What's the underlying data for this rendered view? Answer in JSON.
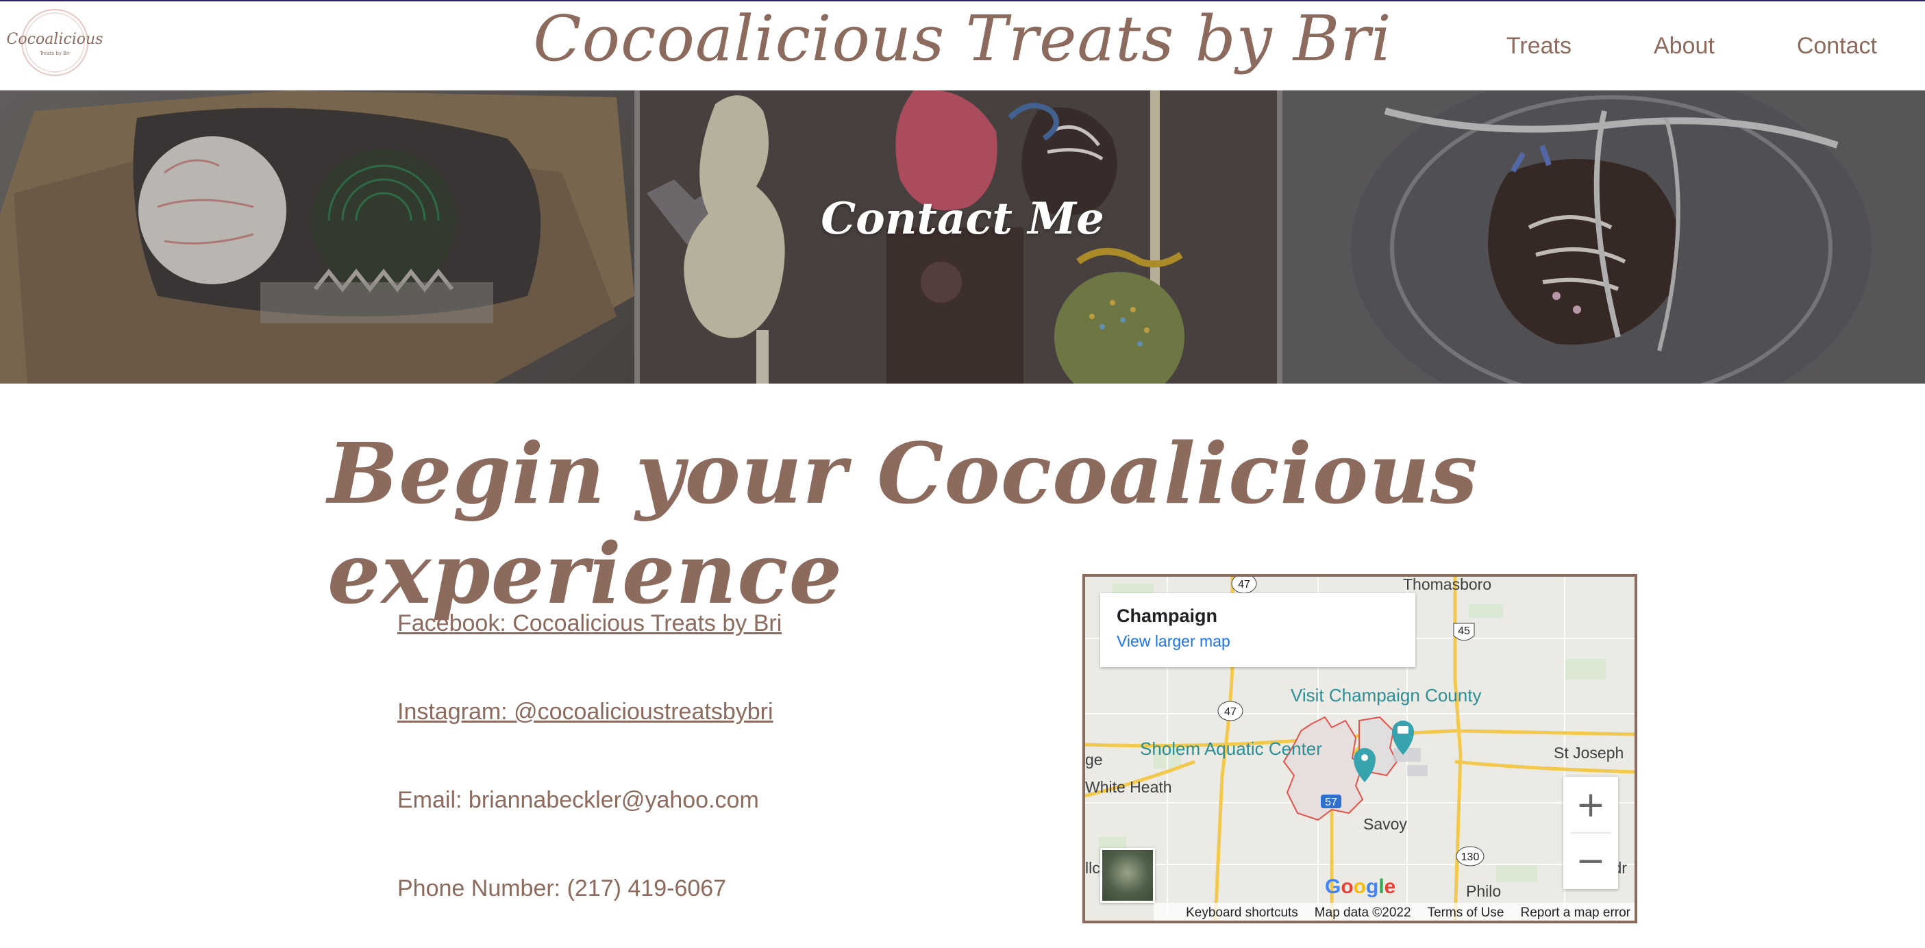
{
  "header": {
    "logo_text": "Cocoalicious",
    "logo_subtext": "Treats by Bri",
    "site_title": "Cocoalicious Treats by Bri",
    "nav": [
      {
        "label": "Treats"
      },
      {
        "label": "About"
      },
      {
        "label": "Contact"
      }
    ]
  },
  "hero": {
    "title": "Contact Me"
  },
  "main": {
    "headline": "Begin your Cocoalicious experience",
    "contacts": [
      {
        "text": "Facebook: Cocoalicious Treats by Bri",
        "link": true
      },
      {
        "text": "Instagram: @cocoalicioustreatsbybri",
        "link": true
      },
      {
        "text": "Email: briannabeckler@yahoo.com",
        "link": false
      },
      {
        "text": "Phone Number: (217) 419-6067",
        "link": false
      }
    ]
  },
  "map": {
    "card_title": "Champaign",
    "card_link": "View larger map",
    "places": [
      "Thomasboro",
      "St Joseph",
      "White Heath",
      "Savoy",
      "Philo",
      "ge",
      "llc",
      "Sidr"
    ],
    "pois": [
      "Visit Champaign County",
      "Sholem Aquatic Center"
    ],
    "route_shields": [
      "47",
      "45",
      "47",
      "130",
      "57"
    ],
    "zoom_in": "+",
    "zoom_out": "−",
    "google": "Google",
    "footer": [
      "Keyboard shortcuts",
      "Map data ©2022",
      "Terms of Use",
      "Report a map error"
    ]
  },
  "colors": {
    "brand": "#8c6a5d",
    "link_blue": "#1a73e8",
    "poi_teal": "#2a8f96"
  }
}
